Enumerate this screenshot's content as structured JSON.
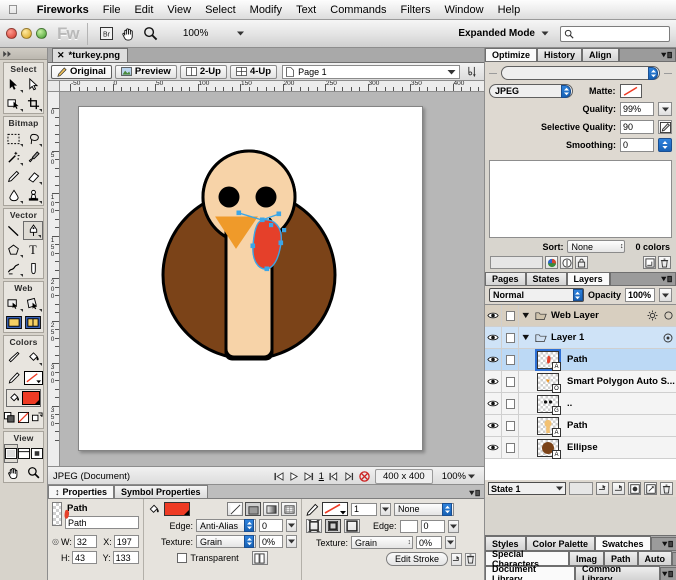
{
  "menubar": {
    "apple_icon": "apple-logo",
    "items": [
      "Fireworks",
      "File",
      "Edit",
      "View",
      "Select",
      "Modify",
      "Text",
      "Commands",
      "Filters",
      "Window",
      "Help"
    ]
  },
  "toolstrip": {
    "app_badge": "Fw",
    "bridge_icon": "Br",
    "hand_icon": "hand-icon",
    "zoom_icon": "magnifier-icon",
    "zoom_level": "100%",
    "expanded_mode_label": "Expanded Mode",
    "search_placeholder": ""
  },
  "tools": {
    "groups": [
      {
        "title": "Select",
        "tools": [
          [
            "pointer-tool",
            "subselection-tool"
          ],
          [
            "select-behind-tool",
            "crop-tool"
          ]
        ]
      },
      {
        "title": "Bitmap",
        "tools": [
          [
            "marquee-tool",
            "lasso-tool"
          ],
          [
            "magic-wand-tool",
            "brush-tool"
          ],
          [
            "pencil-tool",
            "eraser-tool"
          ],
          [
            "blur-tool",
            "rubber-stamp-tool"
          ]
        ]
      },
      {
        "title": "Vector",
        "tools": [
          [
            "line-tool",
            "pen-tool"
          ],
          [
            "rectangle-tool",
            "text-tool"
          ],
          [
            "freeform-tool",
            "knife-tool"
          ]
        ]
      },
      {
        "title": "Web",
        "tools": [
          [
            "rectangle-hotspot-tool",
            "polygon-hotspot-tool"
          ],
          [
            "slice-tool",
            "polygon-slice-tool"
          ]
        ]
      },
      {
        "title": "Colors",
        "tools": [
          [
            "eyedropper-tool",
            "paint-bucket-tool"
          ]
        ]
      },
      {
        "title": "View",
        "tools": [
          [
            "standard-screen-mode",
            "full-screen-with-menus",
            "full-screen-mode"
          ],
          [
            "hand-tool",
            "zoom-tool"
          ]
        ]
      }
    ],
    "fill_color": "#ee3b24",
    "stroke_color": "#ee3b24"
  },
  "document": {
    "tab_title": "*turkey.png",
    "close_icon": "close-icon",
    "view_buttons": [
      {
        "label": "Original",
        "icon": "pencil-icon",
        "active": true
      },
      {
        "label": "Preview",
        "icon": "image-icon",
        "active": false
      },
      {
        "label": "2-Up",
        "icon": "two-up-icon",
        "active": false
      },
      {
        "label": "4-Up",
        "icon": "four-up-icon",
        "active": false
      }
    ],
    "page_selector": {
      "icon": "page-icon",
      "label": "Page 1",
      "caret": "▾"
    },
    "rulers": {
      "horizontal_labels": [
        "-50",
        "0",
        "50",
        "100",
        "150",
        "200",
        "250",
        "300",
        "350",
        "400"
      ],
      "vertical_labels": [
        "0",
        "50",
        "100",
        "150",
        "200",
        "250",
        "300",
        "350"
      ]
    },
    "status": {
      "format": "JPEG (Document)",
      "state_number": "1",
      "dimensions": "400 x 400",
      "zoom": "100%"
    }
  },
  "artwork": {
    "body_color": "#7b4318",
    "body_stroke": "#000000",
    "head_color": "#f7d3a8",
    "head_stroke": "#000000",
    "beak_color": "#ef9a2a",
    "wattle_color": "#e5402a",
    "eye_color": "#000000",
    "selection_color": "#3ba6e8"
  },
  "properties_panel": {
    "tabs": [
      {
        "label": "Properties",
        "active": true
      },
      {
        "label": "Symbol Properties",
        "active": false
      }
    ],
    "object_type": "Path",
    "object_name": "Path",
    "geometry": {
      "w_label": "W:",
      "w_value": "32",
      "h_label": "H:",
      "h_value": "43",
      "x_label": "X:",
      "x_value": "197",
      "y_label": "Y:",
      "y_value": "133"
    },
    "fill": {
      "icon": "paint-bucket-icon",
      "color": "#ee3b24",
      "edge_label": "Edge:",
      "edge_value": "Anti-Alias",
      "edge_amount": "0",
      "texture_label": "Texture:",
      "texture_value": "Grain",
      "texture_amount": "0%",
      "transparent_label": "Transparent",
      "transparent_checked": false
    },
    "stroke": {
      "icon": "pencil-icon",
      "color": "#ee3b24",
      "width": "1",
      "category": "None",
      "edge_label": "Edge:",
      "edge_amount": "0",
      "texture_label": "Texture:",
      "texture_value": "Grain",
      "texture_amount": "0%",
      "edit_stroke_label": "Edit Stroke"
    }
  },
  "right_panels": {
    "top_tabs": [
      {
        "label": "Optimize",
        "active": true
      },
      {
        "label": "History",
        "active": false
      },
      {
        "label": "Align",
        "active": false
      }
    ],
    "optimize": {
      "preset_value": "",
      "format": "JPEG",
      "matte_label": "Matte:",
      "quality_label": "Quality:",
      "quality_value": "99%",
      "selective_quality_label": "Selective Quality:",
      "selective_quality_value": "90",
      "smoothing_label": "Smoothing:",
      "smoothing_value": "0",
      "sort_label": "Sort:",
      "sort_value": "None",
      "colors_count": "0 colors"
    },
    "layers_tabs": [
      {
        "label": "Pages",
        "active": false
      },
      {
        "label": "States",
        "active": false
      },
      {
        "label": "Layers",
        "active": true
      }
    ],
    "layers": {
      "blend_mode": "Normal",
      "opacity_label": "Opacity",
      "opacity_value": "100%",
      "rows": [
        {
          "name": "Web Layer",
          "type": "weblayer",
          "expanded": true,
          "folder": true,
          "badge": "",
          "thumb": "none"
        },
        {
          "name": "Layer 1",
          "type": "sublayer",
          "expanded": true,
          "folder": true,
          "badge": "",
          "thumb": "none"
        },
        {
          "name": "Path",
          "type": "object",
          "selected": true,
          "badge": "A",
          "thumb": "wattle"
        },
        {
          "name": "Smart Polygon Auto S...",
          "type": "object",
          "selected": false,
          "badge": "O",
          "thumb": "beak"
        },
        {
          "name": "..",
          "type": "object",
          "selected": false,
          "badge": "G",
          "thumb": "eyes"
        },
        {
          "name": "Path",
          "type": "object",
          "selected": false,
          "badge": "A",
          "thumb": "head"
        },
        {
          "name": "Ellipse",
          "type": "object",
          "selected": false,
          "badge": "A",
          "thumb": "body"
        }
      ]
    },
    "state_bar": {
      "state_value": "State 1"
    },
    "bottom_tabs": [
      [
        {
          "label": "Styles",
          "active": false
        },
        {
          "label": "Color Palette",
          "active": false
        },
        {
          "label": "Swatches",
          "active": true
        }
      ],
      [
        {
          "label": "Special Characters",
          "active": true
        },
        {
          "label": "Imag",
          "active": false
        },
        {
          "label": "Path",
          "active": false
        },
        {
          "label": "Auto",
          "active": false
        }
      ],
      [
        {
          "label": "Document Library",
          "active": true
        },
        {
          "label": "Common Library",
          "active": false
        }
      ]
    ]
  }
}
